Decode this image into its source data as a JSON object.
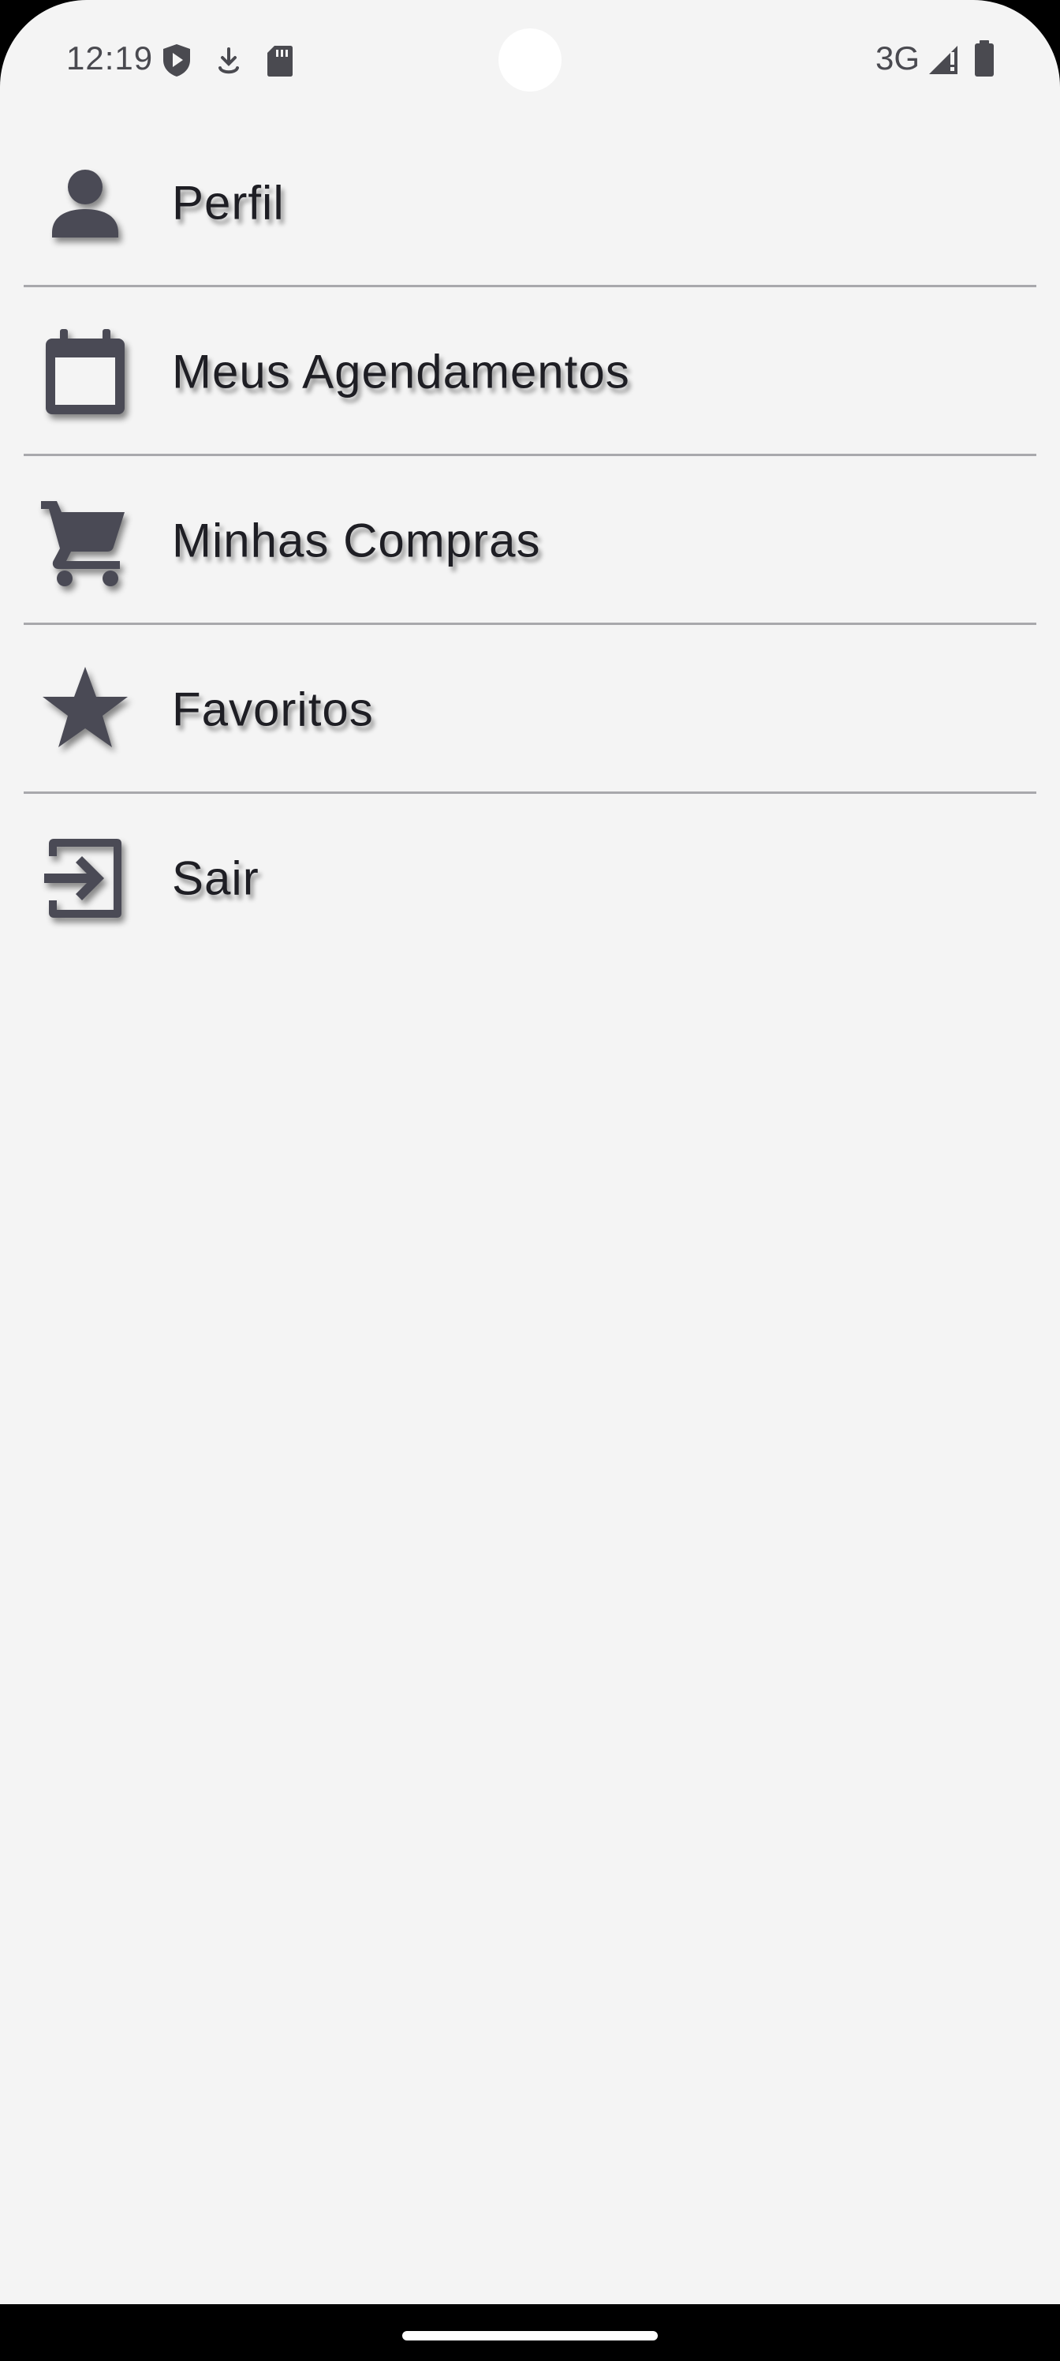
{
  "status_bar": {
    "time": "12:19",
    "network": "3G",
    "icons": [
      "shield-play-icon",
      "download-icon",
      "sd-card-icon",
      "signal-icon",
      "battery-icon"
    ]
  },
  "menu": {
    "items": [
      {
        "label": "Perfil",
        "icon": "person-icon"
      },
      {
        "label": "Meus Agendamentos",
        "icon": "calendar-icon"
      },
      {
        "label": "Minhas Compras",
        "icon": "cart-icon"
      },
      {
        "label": "Favoritos",
        "icon": "star-icon"
      },
      {
        "label": "Sair",
        "icon": "exit-icon"
      }
    ]
  },
  "colors": {
    "background": "#f4f4f4",
    "icon": "#4a4a55",
    "text": "#1e1e24",
    "divider": "#a8a8ac"
  }
}
